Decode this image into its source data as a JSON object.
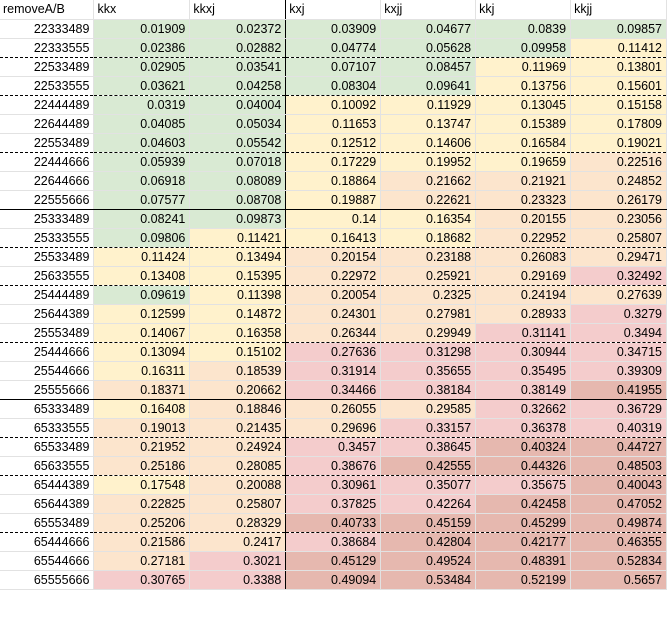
{
  "colors": {
    "green": "#d9ead3",
    "yellow": "#fff2cc",
    "orange": "#fce5cd",
    "pink": "#f4cccc",
    "red": "#e6b8af"
  },
  "headers": [
    "removeA/B",
    "kkx",
    "kkxj",
    "kxj",
    "kxjj",
    "kkj",
    "kkjj"
  ],
  "rows": [
    {
      "id": "22333489",
      "values": [
        "0.01909",
        "0.02372",
        "0.03909",
        "0.04677",
        "0.0839",
        "0.09857"
      ],
      "shade": [
        "g",
        "g",
        "g",
        "g",
        "g",
        "g"
      ],
      "divider": "none"
    },
    {
      "id": "22333555",
      "values": [
        "0.02386",
        "0.02882",
        "0.04774",
        "0.05628",
        "0.09958",
        "0.11412"
      ],
      "shade": [
        "g",
        "g",
        "g",
        "g",
        "g",
        "y"
      ],
      "divider": "dashed"
    },
    {
      "id": "22533489",
      "values": [
        "0.02905",
        "0.03541",
        "0.07107",
        "0.08457",
        "0.11969",
        "0.13801"
      ],
      "shade": [
        "g",
        "g",
        "g",
        "g",
        "y",
        "y"
      ],
      "divider": "none"
    },
    {
      "id": "22533555",
      "values": [
        "0.03621",
        "0.04258",
        "0.08304",
        "0.09641",
        "0.13756",
        "0.15601"
      ],
      "shade": [
        "g",
        "g",
        "g",
        "g",
        "y",
        "y"
      ],
      "divider": "dashed"
    },
    {
      "id": "22444489",
      "values": [
        "0.0319",
        "0.04004",
        "0.10092",
        "0.11929",
        "0.13045",
        "0.15158"
      ],
      "shade": [
        "g",
        "g",
        "y",
        "y",
        "y",
        "y"
      ],
      "divider": "none"
    },
    {
      "id": "22644489",
      "values": [
        "0.04085",
        "0.05034",
        "0.11653",
        "0.13747",
        "0.15389",
        "0.17809"
      ],
      "shade": [
        "g",
        "g",
        "y",
        "y",
        "y",
        "y"
      ],
      "divider": "none"
    },
    {
      "id": "22553489",
      "values": [
        "0.04603",
        "0.05542",
        "0.12512",
        "0.14606",
        "0.16584",
        "0.19021"
      ],
      "shade": [
        "g",
        "g",
        "y",
        "y",
        "y",
        "y"
      ],
      "divider": "dashed"
    },
    {
      "id": "22444666",
      "values": [
        "0.05939",
        "0.07018",
        "0.17229",
        "0.19952",
        "0.19659",
        "0.22516"
      ],
      "shade": [
        "g",
        "g",
        "y",
        "y",
        "y",
        "o"
      ],
      "divider": "none"
    },
    {
      "id": "22644666",
      "values": [
        "0.06918",
        "0.08089",
        "0.18864",
        "0.21662",
        "0.21921",
        "0.24852"
      ],
      "shade": [
        "g",
        "g",
        "y",
        "o",
        "o",
        "o"
      ],
      "divider": "none"
    },
    {
      "id": "22555666",
      "values": [
        "0.07577",
        "0.08708",
        "0.19887",
        "0.22621",
        "0.23323",
        "0.26179"
      ],
      "shade": [
        "g",
        "g",
        "y",
        "o",
        "o",
        "o"
      ],
      "divider": "solid"
    },
    {
      "id": "25333489",
      "values": [
        "0.08241",
        "0.09873",
        "0.14",
        "0.16354",
        "0.20155",
        "0.23056"
      ],
      "shade": [
        "g",
        "g",
        "y",
        "y",
        "o",
        "o"
      ],
      "divider": "none"
    },
    {
      "id": "25333555",
      "values": [
        "0.09806",
        "0.11421",
        "0.16413",
        "0.18682",
        "0.22952",
        "0.25807"
      ],
      "shade": [
        "g",
        "y",
        "y",
        "y",
        "o",
        "o"
      ],
      "divider": "dashed"
    },
    {
      "id": "25533489",
      "values": [
        "0.11424",
        "0.13494",
        "0.20154",
        "0.23188",
        "0.26083",
        "0.29471"
      ],
      "shade": [
        "y",
        "y",
        "o",
        "o",
        "o",
        "o"
      ],
      "divider": "none"
    },
    {
      "id": "25633555",
      "values": [
        "0.13408",
        "0.15395",
        "0.22972",
        "0.25921",
        "0.29169",
        "0.32492"
      ],
      "shade": [
        "y",
        "y",
        "o",
        "o",
        "o",
        "p"
      ],
      "divider": "dashed"
    },
    {
      "id": "25444489",
      "values": [
        "0.09619",
        "0.11398",
        "0.20054",
        "0.2325",
        "0.24194",
        "0.27639"
      ],
      "shade": [
        "g",
        "y",
        "o",
        "o",
        "o",
        "o"
      ],
      "divider": "none"
    },
    {
      "id": "25644389",
      "values": [
        "0.12599",
        "0.14872",
        "0.24301",
        "0.27981",
        "0.28933",
        "0.3279"
      ],
      "shade": [
        "y",
        "y",
        "o",
        "o",
        "o",
        "p"
      ],
      "divider": "none"
    },
    {
      "id": "25553489",
      "values": [
        "0.14067",
        "0.16358",
        "0.26344",
        "0.29949",
        "0.31141",
        "0.3494"
      ],
      "shade": [
        "y",
        "y",
        "o",
        "o",
        "p",
        "p"
      ],
      "divider": "dashed"
    },
    {
      "id": "25444666",
      "values": [
        "0.13094",
        "0.15102",
        "0.27636",
        "0.31298",
        "0.30944",
        "0.34715"
      ],
      "shade": [
        "y",
        "y",
        "p",
        "p",
        "p",
        "p"
      ],
      "divider": "none"
    },
    {
      "id": "25544666",
      "values": [
        "0.16311",
        "0.18539",
        "0.31914",
        "0.35655",
        "0.35495",
        "0.39309"
      ],
      "shade": [
        "y",
        "o",
        "p",
        "p",
        "p",
        "p"
      ],
      "divider": "none"
    },
    {
      "id": "25555666",
      "values": [
        "0.18371",
        "0.20662",
        "0.34466",
        "0.38184",
        "0.38149",
        "0.41955"
      ],
      "shade": [
        "o",
        "o",
        "p",
        "p",
        "p",
        "r"
      ],
      "divider": "solid"
    },
    {
      "id": "65333489",
      "values": [
        "0.16408",
        "0.18846",
        "0.26055",
        "0.29585",
        "0.32662",
        "0.36729"
      ],
      "shade": [
        "y",
        "o",
        "o",
        "o",
        "p",
        "p"
      ],
      "divider": "none"
    },
    {
      "id": "65333555",
      "values": [
        "0.19013",
        "0.21435",
        "0.29696",
        "0.33157",
        "0.36378",
        "0.40319"
      ],
      "shade": [
        "o",
        "o",
        "o",
        "p",
        "p",
        "p"
      ],
      "divider": "dashed"
    },
    {
      "id": "65533489",
      "values": [
        "0.21952",
        "0.24924",
        "0.3457",
        "0.38645",
        "0.40324",
        "0.44727"
      ],
      "shade": [
        "o",
        "o",
        "p",
        "p",
        "r",
        "r"
      ],
      "divider": "none"
    },
    {
      "id": "65633555",
      "values": [
        "0.25186",
        "0.28085",
        "0.38676",
        "0.42555",
        "0.44326",
        "0.48503"
      ],
      "shade": [
        "o",
        "o",
        "p",
        "r",
        "r",
        "r"
      ],
      "divider": "dashed"
    },
    {
      "id": "65444389",
      "values": [
        "0.17548",
        "0.20088",
        "0.30961",
        "0.35077",
        "0.35675",
        "0.40043"
      ],
      "shade": [
        "y",
        "o",
        "p",
        "p",
        "p",
        "r"
      ],
      "divider": "none"
    },
    {
      "id": "65644389",
      "values": [
        "0.22825",
        "0.25807",
        "0.37825",
        "0.42264",
        "0.42458",
        "0.47052"
      ],
      "shade": [
        "o",
        "o",
        "p",
        "p",
        "r",
        "r"
      ],
      "divider": "none"
    },
    {
      "id": "65553489",
      "values": [
        "0.25206",
        "0.28329",
        "0.40733",
        "0.45159",
        "0.45299",
        "0.49874"
      ],
      "shade": [
        "o",
        "o",
        "r",
        "r",
        "r",
        "r"
      ],
      "divider": "dashed"
    },
    {
      "id": "65444666",
      "values": [
        "0.21586",
        "0.2417",
        "0.38684",
        "0.42804",
        "0.42177",
        "0.46355"
      ],
      "shade": [
        "o",
        "o",
        "p",
        "r",
        "r",
        "r"
      ],
      "divider": "none"
    },
    {
      "id": "65544666",
      "values": [
        "0.27181",
        "0.3021",
        "0.45129",
        "0.49524",
        "0.48391",
        "0.52834"
      ],
      "shade": [
        "o",
        "p",
        "r",
        "r",
        "r",
        "r"
      ],
      "divider": "none"
    },
    {
      "id": "65555666",
      "values": [
        "0.30765",
        "0.3388",
        "0.49094",
        "0.53484",
        "0.52199",
        "0.5657"
      ],
      "shade": [
        "p",
        "p",
        "r",
        "r",
        "r",
        "r"
      ],
      "divider": "none"
    }
  ]
}
